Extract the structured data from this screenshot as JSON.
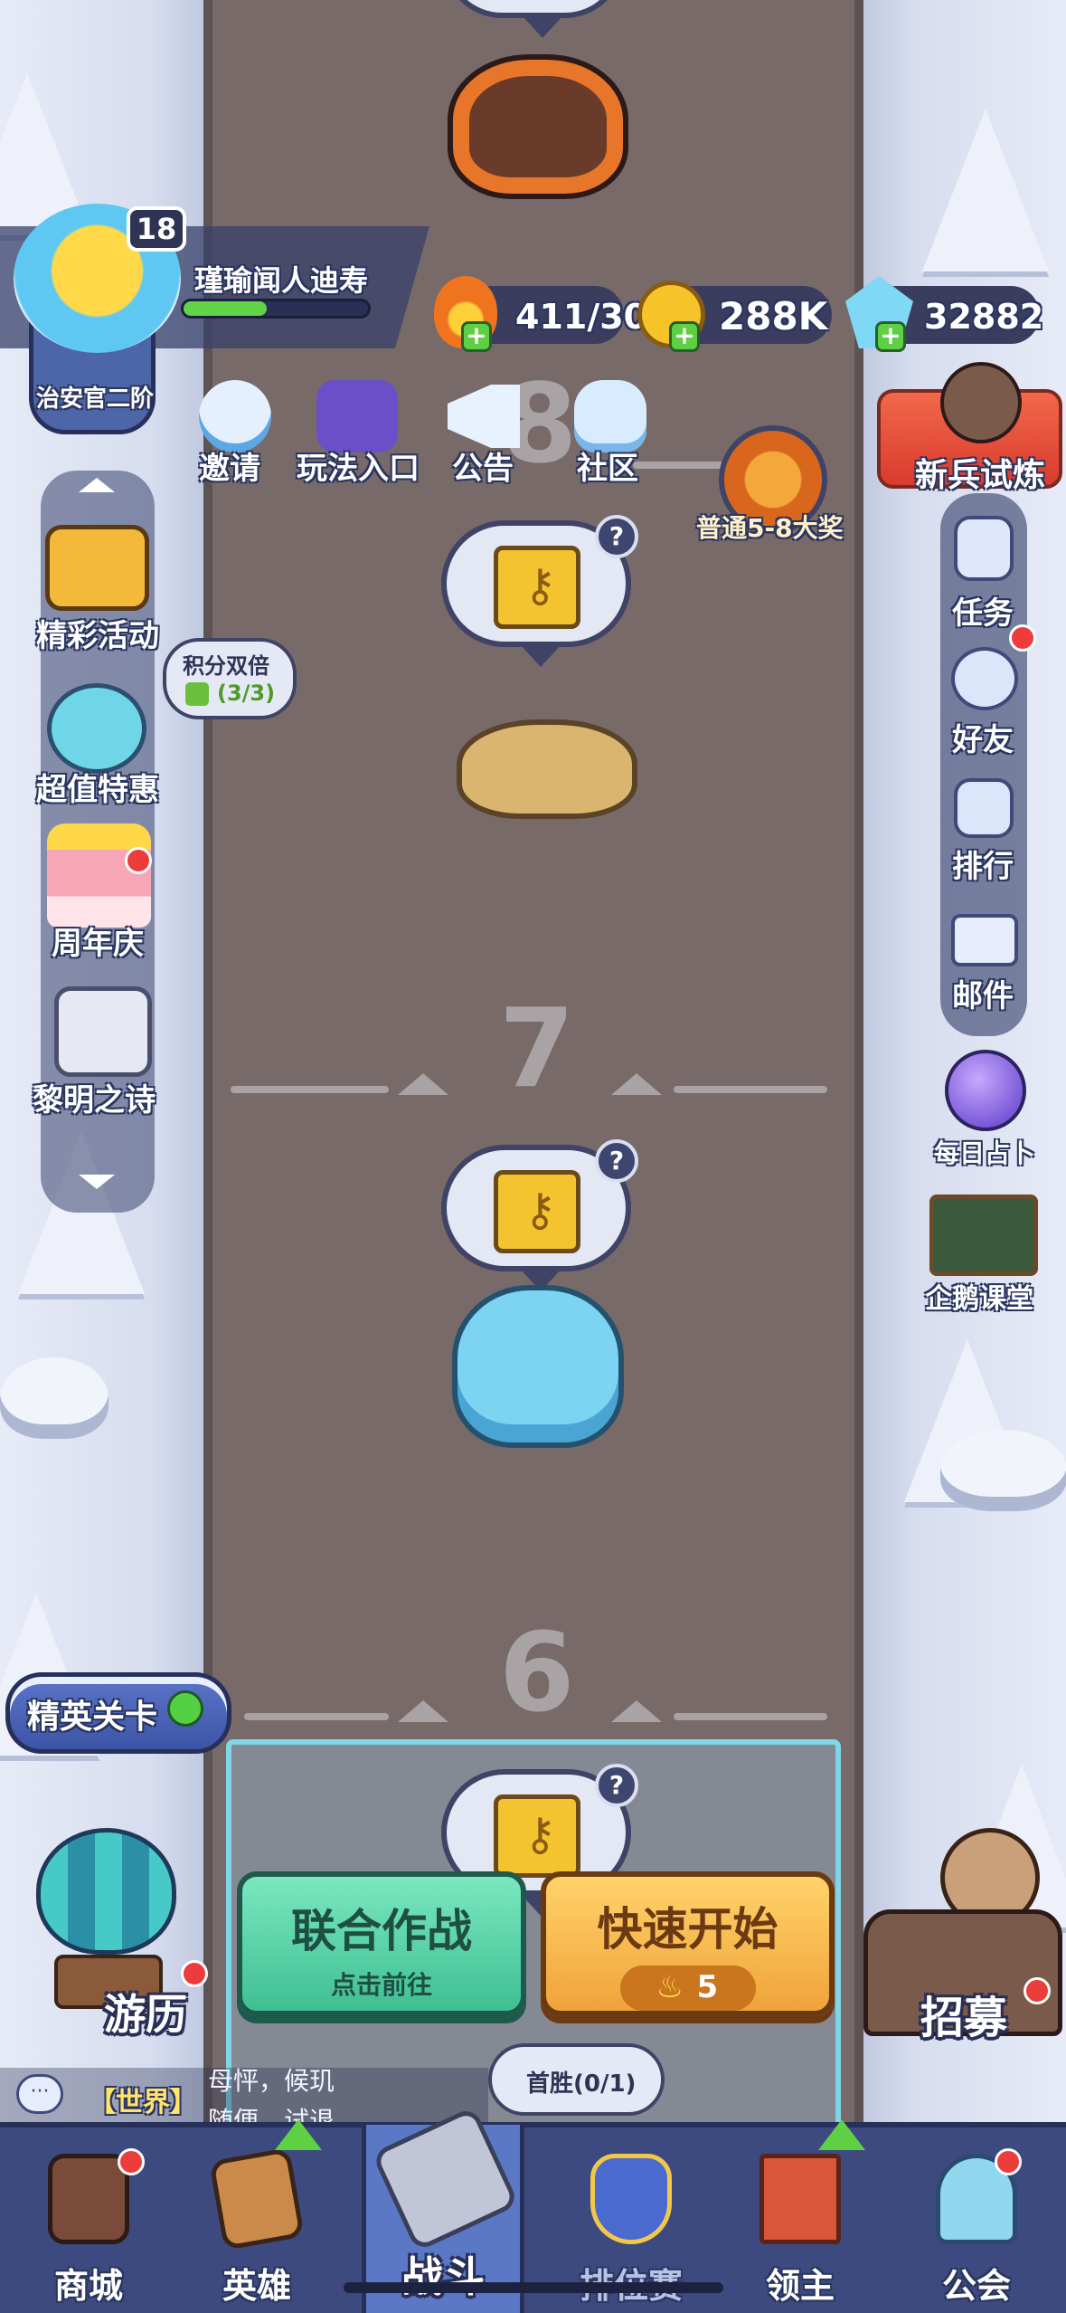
{
  "player": {
    "level": "18",
    "name": "瑾瑜闻人迪寿",
    "rank": "治安官二阶",
    "xp_fraction": 0.45
  },
  "resources": {
    "stamina": "411/30",
    "gold": "288K",
    "gems": "32882"
  },
  "top_menu": {
    "invite": "邀请",
    "gameplay": "玩法入口",
    "notice": "公告",
    "community": "社区"
  },
  "rookie_trial": "新兵试炼",
  "stage_reward": "普通5-8大奖",
  "stages": {
    "s7": "7",
    "s6": "6",
    "s8": "8"
  },
  "left_menu": {
    "events": "精彩活动",
    "deals": "超值特惠",
    "anniversary": "周年庆",
    "dawn_poem": "黎明之诗",
    "double_points_title": "积分双倍",
    "double_points_count": "(3/3)"
  },
  "right_menu": {
    "tasks": "任务",
    "friends": "好友",
    "ranking": "排行",
    "mail": "邮件",
    "daily_fortune": "每日占卜",
    "penguin_class": "企鹅课堂"
  },
  "elite_stage": "精英关卡",
  "travel": "游历",
  "recruit": "招募",
  "coop_battle": {
    "title": "联合作战",
    "subtitle": "点击前往"
  },
  "quick_start": {
    "title": "快速开始",
    "cost": "5"
  },
  "first_win": "首胜(0/1)",
  "chat": {
    "channel": "【世界】",
    "line1": "母怦，候玑",
    "line2": "随便，试退"
  },
  "bottom_nav": {
    "shop": "商城",
    "heroes": "英雄",
    "battle": "战斗",
    "ranked": "排位赛",
    "lord": "领主",
    "guild": "公会"
  },
  "colors": {
    "road": "#776a69",
    "snow": "#dbe0f0",
    "nav_bg": "#3d4a7f",
    "green_button": "#43c99b",
    "orange_button": "#f1a83a"
  }
}
